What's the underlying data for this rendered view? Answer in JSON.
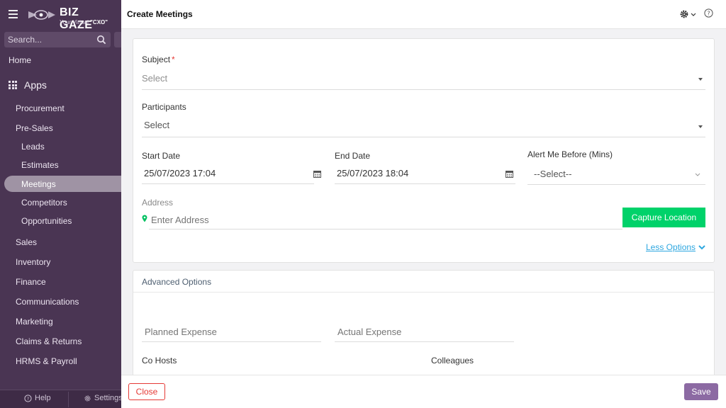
{
  "brand": {
    "name": "BIZ GAZE",
    "tagline_prefix": "Your Virtual ",
    "tagline_strong": "\"CXO\"",
    "trademark": "TM"
  },
  "sidebar": {
    "search_placeholder": "Search...",
    "home": "Home",
    "apps": "Apps",
    "items": [
      {
        "label": "Procurement"
      },
      {
        "label": "Pre-Sales"
      },
      {
        "label": "Leads"
      },
      {
        "label": "Estimates"
      },
      {
        "label": "Meetings",
        "active": true
      },
      {
        "label": "Competitors"
      },
      {
        "label": "Opportunities"
      },
      {
        "label": "Sales"
      },
      {
        "label": "Inventory"
      },
      {
        "label": "Finance"
      },
      {
        "label": "Communications"
      },
      {
        "label": "Marketing"
      },
      {
        "label": "Claims & Returns"
      },
      {
        "label": "HRMS & Payroll"
      }
    ],
    "footer": {
      "help": "Help",
      "settings": "Settings"
    }
  },
  "header": {
    "title": "Create Meetings"
  },
  "form": {
    "subject": {
      "label": "Subject",
      "required_mark": "*",
      "value": "Select"
    },
    "participants": {
      "label": "Participants",
      "value": "Select"
    },
    "start_date": {
      "label": "Start Date",
      "value": "25/07/2023 17:04"
    },
    "end_date": {
      "label": "End Date",
      "value": "25/07/2023 18:04"
    },
    "alert": {
      "label": "Alert Me Before (Mins)",
      "value": "--Select--"
    },
    "address": {
      "label": "Address",
      "placeholder": "Enter Address"
    },
    "capture_location": "Capture Location",
    "less_options": "Less Options"
  },
  "advanced": {
    "title": "Advanced Options",
    "planned_expense_placeholder": "Planned Expense",
    "actual_expense_placeholder": "Actual Expense",
    "co_hosts": "Co Hosts",
    "colleagues": "Colleagues"
  },
  "footer": {
    "close": "Close",
    "save": "Save"
  },
  "colors": {
    "sidebar_bg": "#4a3553",
    "accent_green": "#00d26a",
    "close_red": "#e53935",
    "save_purple": "#8c6aa3",
    "link_blue": "#2ea7e0"
  }
}
